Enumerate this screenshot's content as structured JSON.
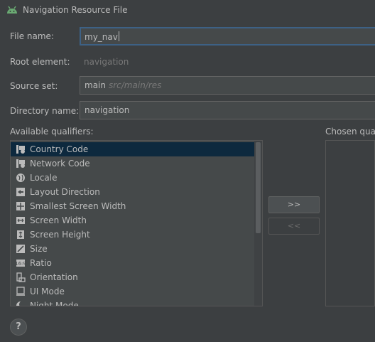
{
  "dialog": {
    "title": "Navigation Resource File",
    "icon": "android-icon"
  },
  "form": {
    "file_name": {
      "label": "File name:",
      "value": "my_nav"
    },
    "root_element": {
      "label": "Root element:",
      "value": "navigation"
    },
    "source_set": {
      "label": "Source set:",
      "value": "main",
      "hint": "src/main/res"
    },
    "directory_name": {
      "label": "Directory name:",
      "value": "navigation"
    }
  },
  "qualifiers": {
    "available_label": "Available qualifiers:",
    "chosen_label": "Chosen quali",
    "items": [
      {
        "label": "Country Code",
        "icon": "country-code-icon",
        "selected": true
      },
      {
        "label": "Network Code",
        "icon": "network-code-icon"
      },
      {
        "label": "Locale",
        "icon": "globe-icon"
      },
      {
        "label": "Layout Direction",
        "icon": "layout-direction-icon"
      },
      {
        "label": "Smallest Screen Width",
        "icon": "smallest-width-icon"
      },
      {
        "label": "Screen Width",
        "icon": "screen-width-icon"
      },
      {
        "label": "Screen Height",
        "icon": "screen-height-icon"
      },
      {
        "label": "Size",
        "icon": "size-icon"
      },
      {
        "label": "Ratio",
        "icon": "ratio-icon"
      },
      {
        "label": "Orientation",
        "icon": "orientation-icon"
      },
      {
        "label": "UI Mode",
        "icon": "ui-mode-icon"
      },
      {
        "label": "Night Mode",
        "icon": "night-mode-icon"
      }
    ],
    "add_button": ">>",
    "remove_button": "<<"
  },
  "footer": {
    "help": "?"
  }
}
